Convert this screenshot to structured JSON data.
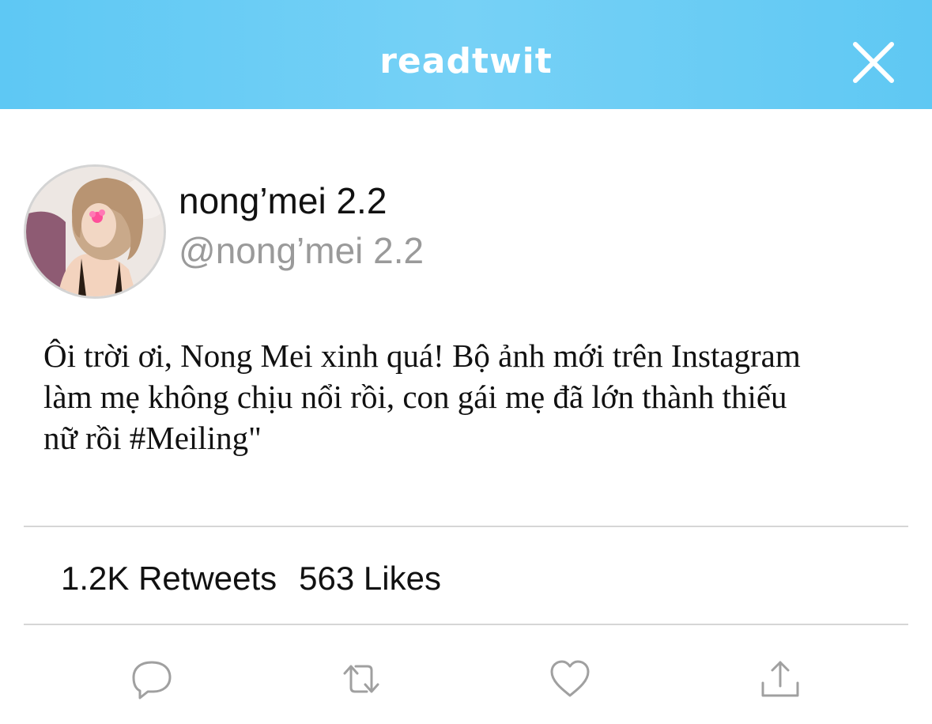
{
  "header": {
    "brand": "readtwit",
    "close_icon": "close-icon",
    "background": "#6fcff6"
  },
  "user": {
    "display_name": "nong’mei 2.2",
    "handle": "@nong’mei 2.2",
    "avatar_icon": "profile-photo"
  },
  "tweet": {
    "lines": [
      "Ôi trời ơi, Nong Mei xinh quá! Bộ ảnh mới trên Instagram",
      "làm mẹ không chịu nổi rồi, con gái mẹ đã lớn thành thiếu",
      "nữ rồi  #Meiling\""
    ]
  },
  "stats": {
    "retweets": "1.2K Retweets",
    "likes": "563 Likes"
  },
  "actions": [
    {
      "icon": "reply-icon"
    },
    {
      "icon": "retweet-icon"
    },
    {
      "icon": "heart-icon"
    },
    {
      "icon": "share-icon"
    }
  ]
}
